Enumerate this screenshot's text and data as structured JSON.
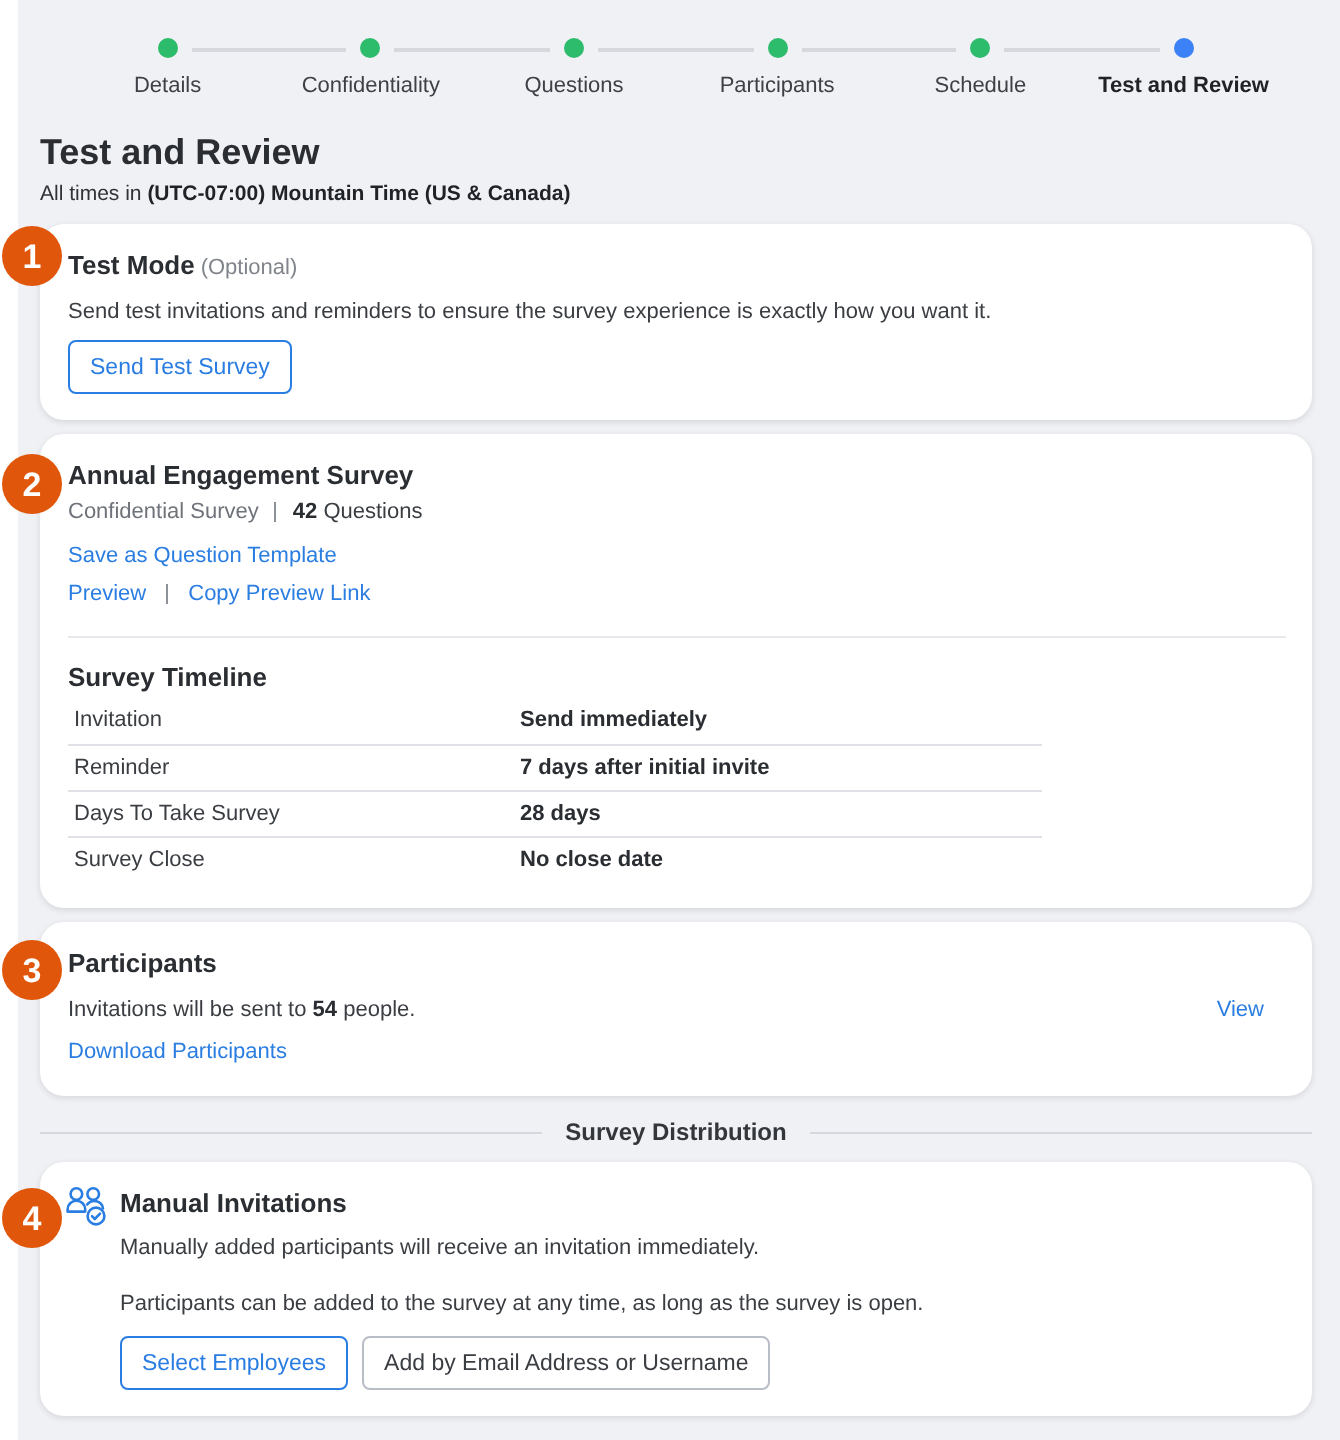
{
  "stepper": {
    "steps": [
      {
        "label": "Details",
        "completed": true,
        "selected": false
      },
      {
        "label": "Confidentiality",
        "completed": true,
        "selected": false
      },
      {
        "label": "Questions",
        "completed": true,
        "selected": false
      },
      {
        "label": "Participants",
        "completed": true,
        "selected": false
      },
      {
        "label": "Schedule",
        "completed": true,
        "selected": false
      },
      {
        "label": "Test and Review",
        "completed": false,
        "selected": true
      }
    ]
  },
  "page": {
    "title": "Test and Review",
    "timezone_note": "All times in **(UTC-07:00) Mountain Time (US & Canada)**"
  },
  "test_mode": {
    "number": "1",
    "title": "Test Mode",
    "title_note": "(Optional)",
    "description": "Send test invitations and reminders to ensure the survey experience is exactly how you want it.",
    "buttons": [
      {
        "label": "Send Test Survey",
        "kind": "primary"
      }
    ]
  },
  "survey": {
    "number": "2",
    "title": "Annual Engagement Survey",
    "meta": {
      "survey_type": "Confidential Survey",
      "question_count": "**42** Questions"
    },
    "links": [
      [
        "Save as Question Template"
      ],
      [
        "Preview",
        "Copy Preview Link"
      ]
    ],
    "timeline": {
      "title": "Survey Timeline",
      "rows": [
        {
          "label": "Invitation",
          "value": "Send immediately"
        },
        {
          "label": "Reminder",
          "value": "7 days after initial invite"
        },
        {
          "label": "Days To Take Survey",
          "value": "28 days"
        },
        {
          "label": "Survey Close",
          "value": "No close date"
        }
      ]
    }
  },
  "participants": {
    "number": "3",
    "title": "Participants",
    "summary": "Invitations will be sent to **54** people.",
    "view_link": "View",
    "download_link": "Download Participants"
  },
  "distribution": {
    "title": "Survey Distribution"
  },
  "manual_invitations": {
    "number": "4",
    "title": "Manual Invitations",
    "paragraphs": [
      "Manually added participants will receive an invitation immediately.",
      "Participants can be added to the survey at any time, as long as the survey is open."
    ],
    "buttons": [
      {
        "label": "Select Employees",
        "kind": "primary"
      },
      {
        "label": "Add by Email Address or Username",
        "kind": "secondary"
      }
    ]
  }
}
